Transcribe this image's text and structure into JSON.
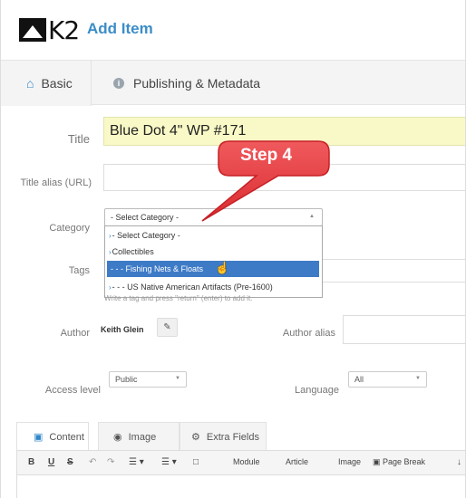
{
  "header": {
    "logo_text": "K2",
    "title": "Add Item"
  },
  "tabs": [
    {
      "label": "Basic",
      "icon": "home-icon",
      "active": true
    },
    {
      "label": "Publishing & Metadata",
      "icon": "info-icon",
      "active": false
    }
  ],
  "form": {
    "title_label": "Title",
    "title_value": "Blue Dot 4\" WP #171",
    "alias_label": "Title alias (URL)",
    "alias_value": "",
    "category_label": "Category",
    "category_selected": "- Select Category -",
    "category_options": [
      {
        "label": "- Select Category -",
        "has_chevron": true,
        "highlighted": false
      },
      {
        "label": "Collectibles",
        "has_chevron": true,
        "highlighted": false
      },
      {
        "label": "- - - Fishing Nets & Floats",
        "has_chevron": false,
        "highlighted": true
      },
      {
        "label": "- - - US Native American Artifacts (Pre-1600)",
        "has_chevron": true,
        "highlighted": false
      }
    ],
    "tags_label": "Tags",
    "tags_help": "Write a tag and press \"return\" (enter) to add it.",
    "author_label": "Author",
    "author_name": "Keith Glein",
    "author_alias_label": "Author alias",
    "access_label": "Access level",
    "access_value": "Public",
    "language_label": "Language",
    "language_value": "All"
  },
  "callout": {
    "text": "Step 4",
    "color": "#e8373b"
  },
  "editor": {
    "tabs": [
      {
        "label": "Content",
        "icon": "file-icon",
        "active": true
      },
      {
        "label": "Image",
        "icon": "camera-icon",
        "active": false
      },
      {
        "label": "Extra Fields",
        "icon": "gear-icon",
        "active": false
      }
    ],
    "toolbar": {
      "bold": "B",
      "underline": "U",
      "strike": "S",
      "module": "Module",
      "article": "Article",
      "image": "Image",
      "page_break": "Page Break"
    }
  },
  "colors": {
    "accent": "#2f86c8",
    "title_bg": "#f9f9c7",
    "highlight": "#3e7bc7"
  }
}
